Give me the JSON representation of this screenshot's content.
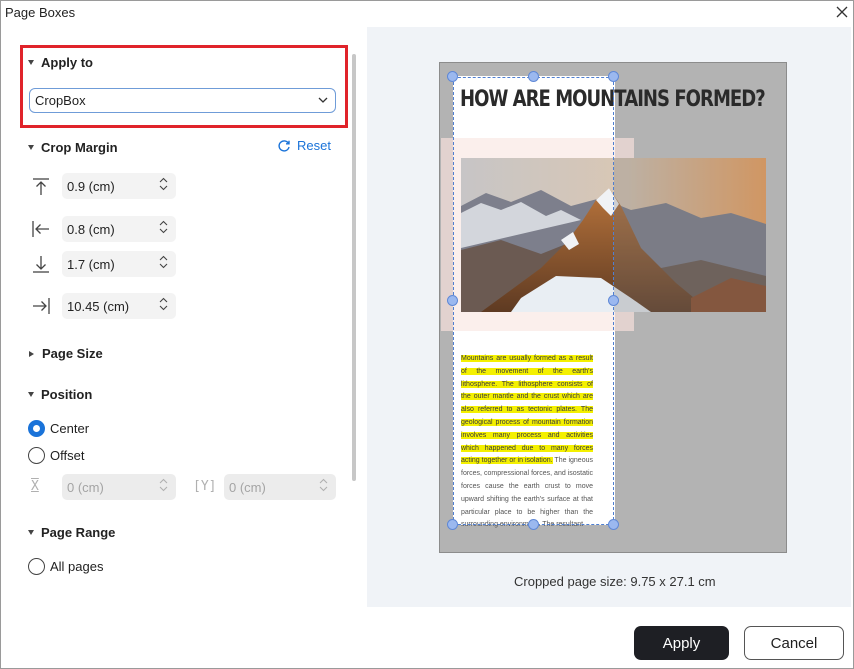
{
  "window": {
    "title": "Page Boxes",
    "close_icon": "close-icon"
  },
  "apply_to": {
    "heading": "Apply to",
    "selected": "CropBox"
  },
  "crop_margin": {
    "heading": "Crop Margin",
    "reset_label": "Reset",
    "top": "0.9 (cm)",
    "left": "0.8 (cm)",
    "bottom": "1.7 (cm)",
    "right": "10.45 (cm)"
  },
  "page_size": {
    "heading": "Page Size"
  },
  "position": {
    "heading": "Position",
    "center_label": "Center",
    "offset_label": "Offset",
    "selected": "Center",
    "x_icon": "X",
    "y_icon": "Y",
    "x_value": "0 (cm)",
    "y_value": "0 (cm)"
  },
  "page_range": {
    "heading": "Page Range",
    "all_pages_label": "All pages"
  },
  "preview": {
    "headline": "HOW ARE MOUNTAINS FORMED?",
    "highlighted_text": "Mountains are usually formed as a result of the movement of the earth's lithosphere. The lithosphere consists of the outer mantle and the crust which are also referred to as tectonic plates. The geological process of mountain formation involves many process and activities which happened due to many forces acting together or in isolation.",
    "plain_text": " The igneous forces, compressional forces, and isostatic forces cause the earth crust to move upward shifting the earth's surface at that particular place to be higher than the surrounding environment. The resultant",
    "cropped_size": "Cropped page size: 9.75 x 27.1 cm"
  },
  "buttons": {
    "apply": "Apply",
    "cancel": "Cancel"
  },
  "colors": {
    "accent": "#1a73d9",
    "highlight_border": "#e0232a",
    "primary_button": "#1e1f24"
  }
}
